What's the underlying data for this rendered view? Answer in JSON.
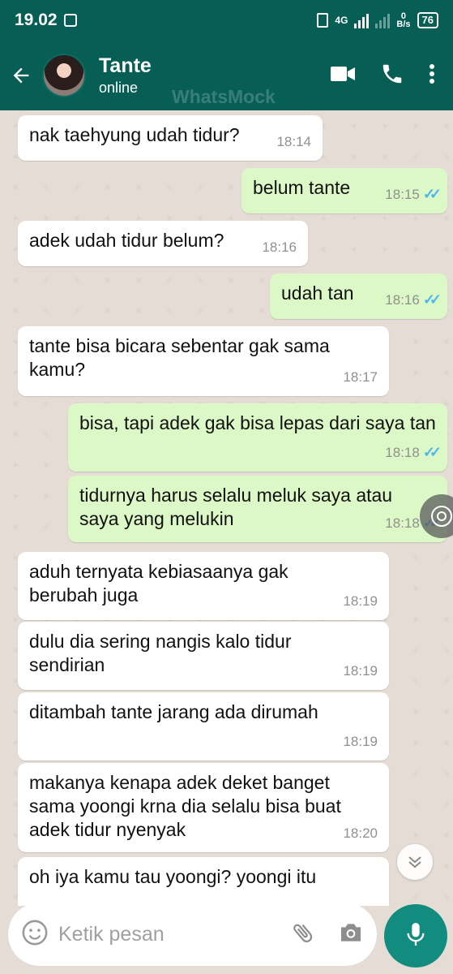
{
  "status_bar": {
    "time": "19.02",
    "net_rate_value": "0",
    "net_rate_unit": "B/s",
    "network": "4G",
    "battery": "76"
  },
  "header": {
    "contact_name": "Tante",
    "contact_status": "online",
    "watermark": "WhatsMock"
  },
  "colors": {
    "header": "#075e54",
    "bubble_out": "#dcf8c6",
    "bubble_in": "#ffffff",
    "ticks": "#4fb6ec",
    "mic": "#128c7e"
  },
  "messages": [
    {
      "dir": "in",
      "text": "nak taehyung udah tidur?",
      "time": "18:14"
    },
    {
      "dir": "out",
      "text": "belum tante",
      "time": "18:15",
      "read": true
    },
    {
      "dir": "in",
      "text": "adek udah tidur belum?",
      "time": "18:16"
    },
    {
      "dir": "out",
      "text": "udah tan",
      "time": "18:16",
      "read": true
    },
    {
      "dir": "in",
      "text": "tante bisa bicara sebentar gak sama kamu?",
      "time": "18:17"
    },
    {
      "dir": "out",
      "text": "bisa, tapi adek gak bisa lepas dari saya tan",
      "time": "18:18",
      "read": true
    },
    {
      "dir": "out",
      "text": "tidurnya harus selalu meluk saya atau saya yang melukin",
      "time": "18:18",
      "read": true
    },
    {
      "dir": "in",
      "text": "aduh ternyata kebiasaanya gak berubah juga",
      "time": "18:19"
    },
    {
      "dir": "in",
      "text": "dulu dia sering nangis kalo tidur sendirian",
      "time": "18:19"
    },
    {
      "dir": "in",
      "text": "ditambah tante jarang ada dirumah",
      "time": "18:19"
    },
    {
      "dir": "in",
      "text": "makanya kenapa adek deket banget sama yoongi krna dia selalu bisa buat adek tidur nyenyak",
      "time": "18:20"
    },
    {
      "dir": "in",
      "text": "oh iya kamu tau yoongi? yoongi itu",
      "time": ""
    }
  ],
  "input": {
    "placeholder": "Ketik pesan"
  },
  "icons": [
    "back-arrow-icon",
    "video-call-icon",
    "phone-icon",
    "more-vert-icon",
    "emoji-icon",
    "attach-icon",
    "camera-icon",
    "mic-icon",
    "chevron-down-icon",
    "read-ticks-icon"
  ]
}
